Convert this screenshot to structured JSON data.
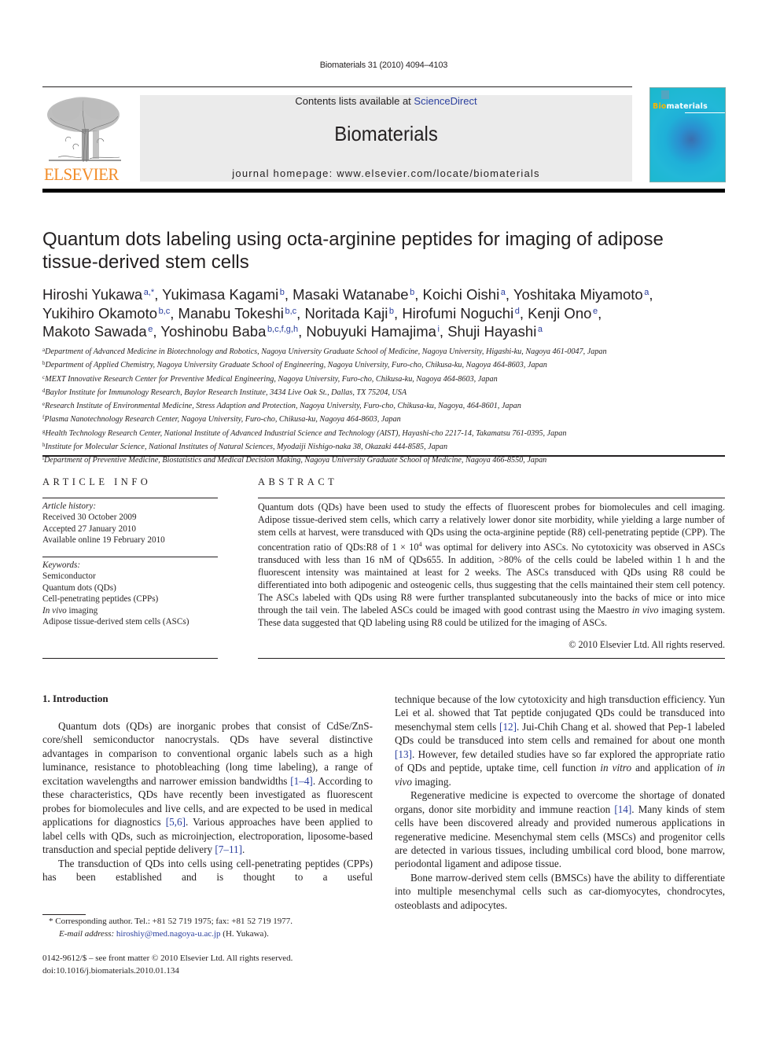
{
  "header": {
    "journal_reference": "Biomaterials 31 (2010) 4094–4103",
    "publisher_logo_text": "ELSEVIER",
    "contents_prefix": "Contents lists available at ",
    "contents_link": "ScienceDirect",
    "journal_title": "Biomaterials",
    "homepage_text": "journal homepage: www.elsevier.com/locate/biomaterials",
    "cover": {
      "title_highlight": "Bio",
      "title_rest": "materials"
    },
    "colors": {
      "elsevier_orange": "#f28c28",
      "link_blue": "#2b3f9e",
      "banner_gray": "#ebebeb"
    }
  },
  "article": {
    "title_line1": "Quantum dots labeling using octa-arginine peptides for imaging of adipose",
    "title_line2": "tissue-derived stem cells",
    "authors": [
      {
        "name": "Hiroshi Yukawa",
        "aff": "a,*",
        "sep": ", "
      },
      {
        "name": "Yukimasa Kagami",
        "aff": "b",
        "sep": ", "
      },
      {
        "name": "Masaki Watanabe",
        "aff": "b",
        "sep": ", "
      },
      {
        "name": "Koichi Oishi",
        "aff": "a",
        "sep": ", "
      },
      {
        "name": "Yoshitaka Miyamoto",
        "aff": "a",
        "sep": ","
      },
      {
        "name": "Yukihiro Okamoto",
        "aff": "b,c",
        "sep": ", "
      },
      {
        "name": "Manabu Tokeshi",
        "aff": "b,c",
        "sep": ", "
      },
      {
        "name": "Noritada Kaji",
        "aff": "b",
        "sep": ", "
      },
      {
        "name": "Hirofumi Noguchi",
        "aff": "d",
        "sep": ", "
      },
      {
        "name": "Kenji Ono",
        "aff": "e",
        "sep": ","
      },
      {
        "name": "Makoto Sawada",
        "aff": "e",
        "sep": ", "
      },
      {
        "name": "Yoshinobu Baba",
        "aff": "b,c,f,g,h",
        "sep": ", "
      },
      {
        "name": "Nobuyuki Hamajima",
        "aff": "i",
        "sep": ", "
      },
      {
        "name": "Shuji Hayashi",
        "aff": "a",
        "sep": ""
      }
    ],
    "affiliations": [
      {
        "key": "a",
        "text": "Department of Advanced Medicine in Biotechnology and Robotics, Nagoya University Graduate School of Medicine, Nagoya University, Higashi-ku, Nagoya 461-0047, Japan"
      },
      {
        "key": "b",
        "text": "Department of Applied Chemistry, Nagoya University Graduate School of Engineering, Nagoya University, Furo-cho, Chikusa-ku, Nagoya 464-8603, Japan"
      },
      {
        "key": "c",
        "text": "MEXT Innovative Research Center for Preventive Medical Engineering, Nagoya University, Furo-cho, Chikusa-ku, Nagoya 464-8603, Japan"
      },
      {
        "key": "d",
        "text": "Baylor Institute for Immunology Research, Baylor Research Institute, 3434 Live Oak St., Dallas, TX 75204, USA"
      },
      {
        "key": "e",
        "text": "Research Institute of Environmental Medicine, Stress Adaption and Protection, Nagoya University, Furo-cho, Chikusa-ku, Nagoya, 464-8601, Japan"
      },
      {
        "key": "f",
        "text": "Plasma Nanotechnology Research Center, Nagoya University, Furo-cho, Chikusa-ku, Nagoya 464-8603, Japan"
      },
      {
        "key": "g",
        "text": "Health Technology Research Center, National Institute of Advanced Industrial Science and Technology (AIST), Hayashi-cho 2217-14, Takamatsu 761-0395, Japan"
      },
      {
        "key": "h",
        "text": "Institute for Molecular Science, National Institutes of Natural Sciences, Myodaiji Nishigo-naka 38, Okazaki 444-8585, Japan"
      },
      {
        "key": "i",
        "text": "Department of Preventive Medicine, Biostatistics and Medical Decision Making, Nagoya University Graduate School of Medicine, Nagoya 466-8550, Japan"
      }
    ]
  },
  "article_info": {
    "heading": "ARTICLE INFO",
    "history_label": "Article history:",
    "history": [
      "Received 30 October 2009",
      "Accepted 27 January 2010",
      "Available online 19 February 2010"
    ],
    "keywords_label": "Keywords:",
    "keywords": [
      "Semiconductor",
      "Quantum dots (QDs)",
      "Cell-penetrating peptides (CPPs)",
      "In vivo imaging",
      "Adipose tissue-derived stem cells (ASCs)"
    ]
  },
  "abstract": {
    "heading": "ABSTRACT",
    "part1": "Quantum dots (QDs) have been used to study the effects of fluorescent probes for biomolecules and cell imaging. Adipose tissue-derived stem cells, which carry a relatively lower donor site morbidity, while yielding a large number of stem cells at harvest, were transduced with QDs using the octa-arginine peptide (R8) cell-penetrating peptide (CPP). The concentration ratio of QDs:R8 of 1 × 10",
    "exponent": "4",
    "part2": " was optimal for delivery into ASCs. No cytotoxicity was observed in ASCs transduced with less than 16 nM of QDs655. In addition, >80% of the cells could be labeled within 1 h and the fluorescent intensity was maintained at least for 2 weeks. The ASCs transduced with QDs using R8 could be differentiated into both adipogenic and osteogenic cells, thus suggesting that the cells maintained their stem cell potency. The ASCs labeled with QDs using R8 were further transplanted subcutaneously into the backs of mice or into mice through the tail vein. The labeled ASCs could be imaged with good contrast using the Maestro ",
    "italic": "in vivo",
    "part3": " imaging system. These data suggested that QD labeling using R8 could be utilized for the imaging of ASCs.",
    "copyright": "© 2010 Elsevier Ltd. All rights reserved."
  },
  "body": {
    "section_heading": "1.  Introduction",
    "left": {
      "p1_a": "Quantum dots (QDs) are inorganic probes that consist of CdSe/ZnS-core/shell semiconductor nanocrystals. QDs have several distinctive advantages in comparison to conventional organic labels such as a high luminance, resistance to photobleaching (long time labeling), a range of excitation wavelengths and narrower emission bandwidths ",
      "ref1": "[1–4]",
      "p1_b": ". According to these characteristics, QDs have recently been investigated as fluorescent probes for biomolecules and live cells, and are expected to be used in medical applications for diagnostics ",
      "ref2": "[5,6]",
      "p1_c": ". Various approaches have been applied to label cells with QDs, such as microinjection, electroporation, liposome-based transduction and special peptide delivery ",
      "ref3": "[7–11]",
      "p1_d": ".",
      "p2": "The transduction of QDs into cells using cell-penetrating peptides (CPPs) has been established and is thought to a useful"
    },
    "right": {
      "p1_a": "technique because of the low cytotoxicity and high transduction efficiency. Yun Lei et al. showed that Tat peptide conjugated QDs could be transduced into mesenchymal stem cells ",
      "ref12": "[12]",
      "p1_b": ". Jui-Chih Chang et al. showed that Pep-1 labeled QDs could be transduced into stem cells and remained for about one month ",
      "ref13": "[13]",
      "p1_c": ". However, few detailed studies have so far explored the appropriate ratio of QDs and peptide, uptake time, cell function ",
      "italic1": "in vitro",
      "p1_d": " and application of ",
      "italic2": "in vivo",
      "p1_e": " imaging.",
      "p2_a": "Regenerative medicine is expected to overcome the shortage of donated organs, donor site morbidity and immune reaction ",
      "ref14": "[14]",
      "p2_b": ". Many kinds of stem cells have been discovered already and provided numerous applications in regenerative medicine. Mesenchymal stem cells (MSCs) and progenitor cells are detected in various tissues, including umbilical cord blood, bone marrow, periodontal ligament and adipose tissue.",
      "p3": "Bone marrow-derived stem cells (BMSCs) have the ability to differentiate into multiple mesenchymal cells such as car-diomyocytes, chondrocytes, osteoblasts and adipocytes."
    }
  },
  "footnotes": {
    "corresponding": "* Corresponding author. Tel.: +81 52 719 1975; fax: +81 52 719 1977.",
    "email_label": "E-mail address: ",
    "email": "hiroshiy@med.nagoya-u.ac.jp",
    "email_suffix": " (H. Yukawa).",
    "front_matter": "0142-9612/$ – see front matter © 2010 Elsevier Ltd. All rights reserved.",
    "doi": "doi:10.1016/j.biomaterials.2010.01.134"
  }
}
